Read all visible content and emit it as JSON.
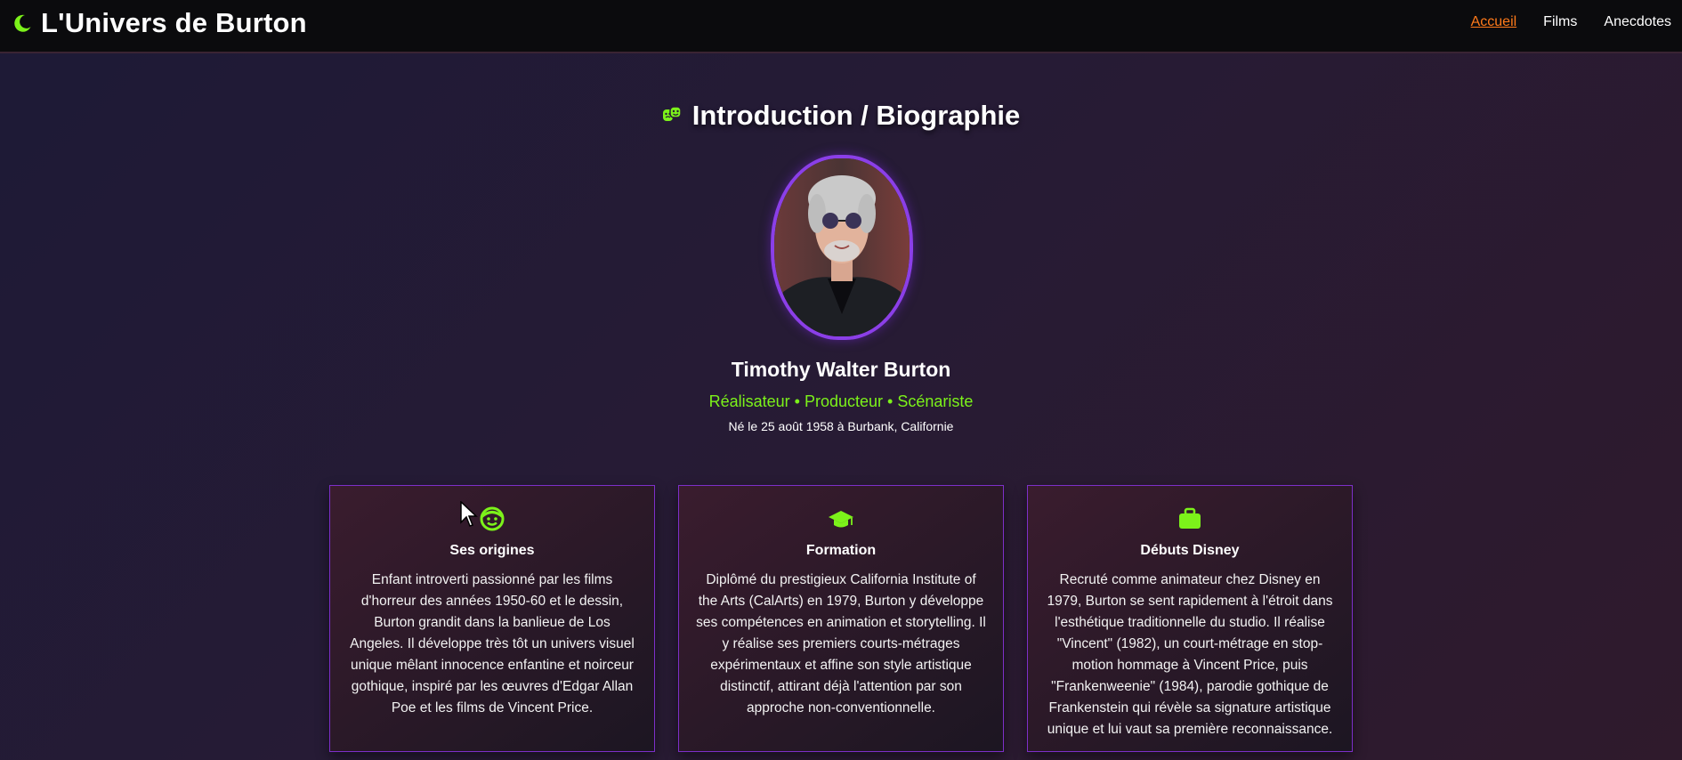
{
  "header": {
    "title": "L'Univers de Burton",
    "nav": [
      {
        "label": "Accueil",
        "active": true
      },
      {
        "label": "Films",
        "active": false
      },
      {
        "label": "Anecdotes",
        "active": false
      }
    ]
  },
  "section": {
    "icon": "theater-masks-icon",
    "title": "Introduction / Biographie"
  },
  "profile": {
    "name": "Timothy Walter Burton",
    "roles": "Réalisateur • Producteur • Scénariste",
    "birth": "Né le 25 août 1958 à Burbank, Californie"
  },
  "cards": [
    {
      "icon": "child-face-icon",
      "title": "Ses origines",
      "text": "Enfant introverti passionné par les films d'horreur des années 1950-60 et le dessin, Burton grandit dans la banlieue de Los Angeles. Il développe très tôt un univers visuel unique mêlant innocence enfantine et noirceur gothique, inspiré par les œuvres d'Edgar Allan Poe et les films de Vincent Price."
    },
    {
      "icon": "graduation-cap-icon",
      "title": "Formation",
      "text": "Diplômé du prestigieux California Institute of the Arts (CalArts) en 1979, Burton y développe ses compétences en animation et storytelling. Il y réalise ses premiers courts-métrages expérimentaux et affine son style artistique distinctif, attirant déjà l'attention par son approche non-conventionnelle."
    },
    {
      "icon": "briefcase-icon",
      "title": "Débuts Disney",
      "text": "Recruté comme animateur chez Disney en 1979, Burton se sent rapidement à l'étroit dans l'esthétique traditionnelle du studio. Il réalise \"Vincent\" (1982), un court-métrage en stop-motion hommage à Vincent Price, puis \"Frankenweenie\" (1984), parodie gothique de Frankenstein qui révèle sa signature artistique unique et lui vaut sa première reconnaissance."
    }
  ],
  "colors": {
    "accent_green": "#7cf21a",
    "active_nav": "#ff7a1a",
    "card_border": "#7d2fc9",
    "portrait_border": "#8b3fe8"
  }
}
